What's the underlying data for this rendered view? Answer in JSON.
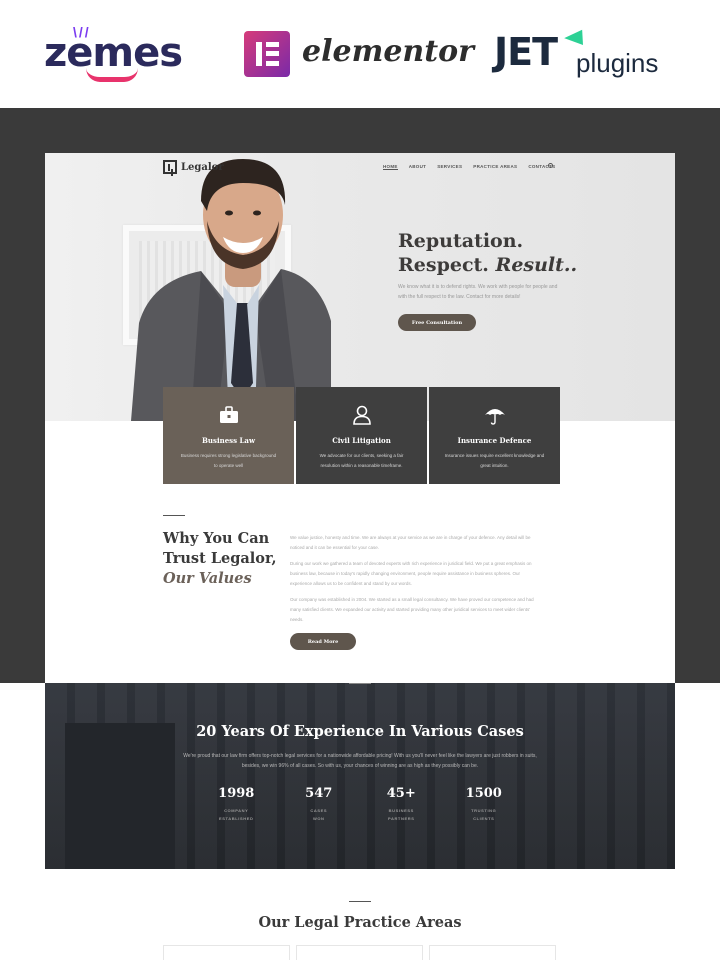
{
  "brands": {
    "zemes": "zemes",
    "elementor": "elementor",
    "jet": "JET",
    "plugins": "plugins"
  },
  "site": {
    "logo": "Legalor",
    "nav": [
      "HOME",
      "ABOUT",
      "SERVICES",
      "PRACTICE AREAS",
      "CONTACTS"
    ],
    "hero": {
      "title_line1": "Reputation.",
      "title_line2_a": "Respect.",
      "title_line2_b": "Result..",
      "text": "We know what it is to defend rights. We work with people for people and with the full respect to the law. Contact for more details!",
      "button": "Free Consultation"
    },
    "cards": [
      {
        "icon": "briefcase-icon",
        "title": "Business Law",
        "text": "Business requires strong legislative background to operate well"
      },
      {
        "icon": "person-icon",
        "title": "Civil Litigation",
        "text": "We advocate for our clients, seeking a fair resolution within a reasonable timeframe."
      },
      {
        "icon": "umbrella-icon",
        "title": "Insurance Defence",
        "text": "Insurance issues require excellent knowledge and great intuition."
      }
    ],
    "why": {
      "title_line1": "Why You Can",
      "title_line2": "Trust Legalor,",
      "title_line3": "Our Values",
      "paragraphs": [
        "We value justice, honesty and time. We are always at your service as we are in charge of your defence. Any detail will be noticed and it can be essential for your case.",
        "During our work we gathered a team of devoted experts with rich experience in juridical field. We put a great emphasis on business law, because in today's rapidly changing environment, people require assistance in business spheres. Our experience allows us to be confident and stand by our words.",
        "Our company was established in 2004. We started as a small legal consultancy. We have proved our competence and had many satisfied clients. We expanded our activity and started providing many other juridical services to meet wider clients' needs."
      ],
      "button": "Read More"
    },
    "experience": {
      "title": "20 Years Of Experience In Various Cases",
      "text": "We're proud that our law firm offers top-notch legal services for a nationwide affordable pricing! With us you'll never feel like the lawyers are just robbers in suits, besides, we win 96% of all cases. So with us, your chances of winning are as high as they possibly can be.",
      "stats": [
        {
          "num": "1998",
          "label1": "COMPANY",
          "label2": "ESTABLISHED"
        },
        {
          "num": "547",
          "label1": "CASES",
          "label2": "WON"
        },
        {
          "num": "45+",
          "label1": "BUSINESS",
          "label2": "PARTNERS"
        },
        {
          "num": "1500",
          "label1": "TRUSTING",
          "label2": "CLIENTS"
        }
      ]
    },
    "areas": {
      "title": "Our Legal Practice Areas"
    }
  }
}
